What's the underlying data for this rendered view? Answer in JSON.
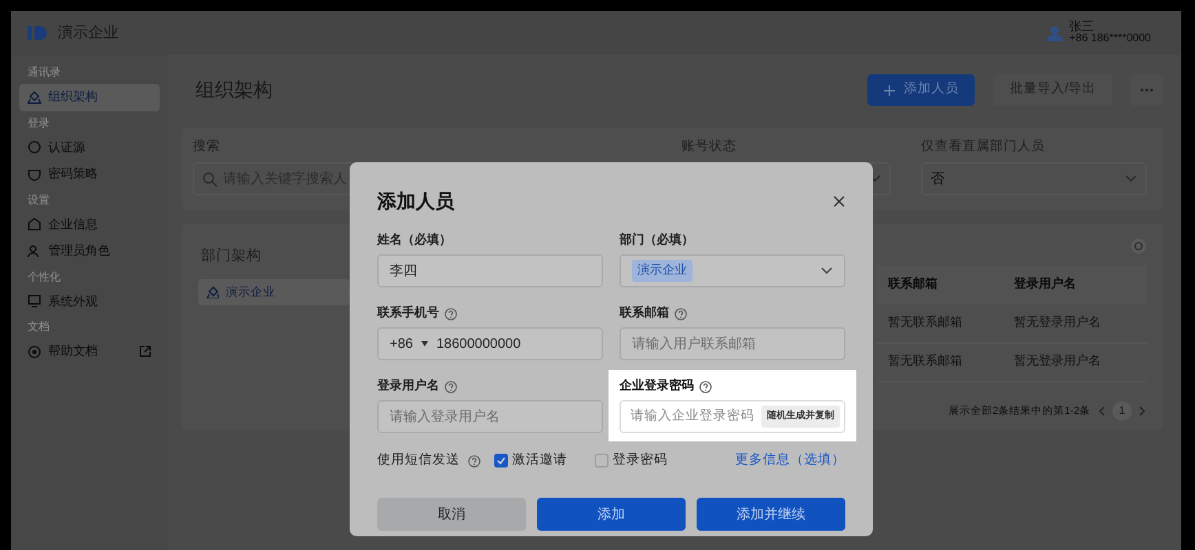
{
  "header": {
    "company": "演示企业",
    "user_name": "张三",
    "user_phone": "+86 186****0000"
  },
  "sidebar": {
    "groups": [
      {
        "label": "通讯录",
        "items": [
          {
            "label": "组织架构",
            "selected": true
          }
        ]
      },
      {
        "label": "登录",
        "items": [
          {
            "label": "认证源",
            "selected": false
          },
          {
            "label": "密码策略",
            "selected": false
          }
        ]
      },
      {
        "label": "设置",
        "items": [
          {
            "label": "企业信息",
            "selected": false
          },
          {
            "label": "管理员角色",
            "selected": false
          }
        ]
      },
      {
        "label": "个性化",
        "items": [
          {
            "label": "系统外观",
            "selected": false
          }
        ]
      },
      {
        "label": "文档",
        "items": [
          {
            "label": "帮助文档",
            "selected": false,
            "external": true
          }
        ]
      }
    ]
  },
  "page": {
    "title": "组织架构",
    "actions": [
      {
        "kind": "primary",
        "label": "添加人员"
      },
      {
        "kind": "secondary",
        "label": "批量导入/导出"
      },
      {
        "kind": "more"
      }
    ]
  },
  "filters": [
    {
      "kind": "search",
      "label": "搜索",
      "placeholder": "请输入关键字搜索人"
    },
    {
      "kind": "select",
      "label": "账号状态"
    },
    {
      "kind": "select",
      "label": "仅查看直属部门人员",
      "value": "否"
    }
  ],
  "departments": {
    "title": "部门架构",
    "items": [
      {
        "label": "演示企业",
        "selected": true
      }
    ]
  },
  "table": {
    "columns": [
      "联系邮箱",
      "登录用户名"
    ],
    "rows": [
      [
        "暂无联系邮箱",
        "暂无登录用户名"
      ],
      [
        "暂无联系邮箱",
        "暂无登录用户名"
      ]
    ],
    "summary": "展示全部2条结果中的第1-2条",
    "pages": [
      {
        "label": "1",
        "selected": true
      }
    ]
  },
  "dialog": {
    "title": "添加人员",
    "fields": [
      {
        "kind": "text",
        "label": "姓名（必填）",
        "help": false,
        "value": "李四",
        "highlighted": false
      },
      {
        "kind": "select",
        "label": "部门（必填）",
        "help": false,
        "tag": "演示企业",
        "highlighted": false
      },
      {
        "kind": "phone",
        "label": "联系手机号",
        "help": true,
        "prefix": "+86",
        "value": "18600000000",
        "highlighted": false
      },
      {
        "kind": "text",
        "label": "联系邮箱",
        "help": true,
        "placeholder": "请输入用户联系邮箱",
        "highlighted": false
      },
      {
        "kind": "text",
        "label": "登录用户名",
        "help": true,
        "placeholder": "请输入登录用户名",
        "highlighted": false
      },
      {
        "kind": "password",
        "label": "企业登录密码",
        "help": true,
        "placeholder": "请输入企业登录密码",
        "action": "随机生成并复制",
        "highlighted": true
      }
    ],
    "sms": {
      "label": "使用短信发送",
      "help": true,
      "options": [
        {
          "label": "激活邀请",
          "checked": true
        },
        {
          "label": "登录密码",
          "checked": false
        }
      ]
    },
    "more_link": "更多信息（选填）",
    "buttons": [
      {
        "kind": "secondary",
        "label": "取消"
      },
      {
        "kind": "primary",
        "label": "添加"
      },
      {
        "kind": "primary",
        "label": "添加并继续"
      }
    ]
  }
}
